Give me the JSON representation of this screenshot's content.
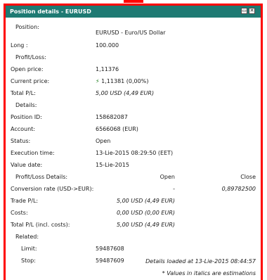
{
  "window": {
    "title": "Position details - EURUSD"
  },
  "position": {
    "label": "Position:",
    "value": "EURUSD - Euro/US Dollar"
  },
  "side": {
    "label": "Long :",
    "value": "100.000"
  },
  "pl_section": "Profit/Loss:",
  "open_price": {
    "label": "Open price:",
    "value": "1,11376"
  },
  "current_price": {
    "label": "Current price:",
    "icon": "up-arrow-icon",
    "value": "1,11381 (0,00%)"
  },
  "total_pl": {
    "label": "Total P/L:",
    "value": "5,00 USD (4,49 EUR)"
  },
  "details_section": "Details:",
  "position_id": {
    "label": "Position ID:",
    "value": "158682087"
  },
  "account": {
    "label": "Account:",
    "value": "6566068 (EUR)"
  },
  "status": {
    "label": "Status:",
    "value": "Open"
  },
  "execution_time": {
    "label": "Execution time:",
    "value": "13-Lie-2015 08:29:50 (EET)"
  },
  "value_date": {
    "label": "Value date:",
    "value": "15-Lie-2015"
  },
  "pl_details": {
    "label": "Profit/Loss Details:",
    "col_open": "Open",
    "col_close": "Close",
    "rows": [
      {
        "label": "Conversion rate (USD->EUR):",
        "open": "-",
        "close": "0,89782500"
      },
      {
        "label": "Trade P/L:",
        "open": "5,00 USD (4,49 EUR)",
        "close": ""
      },
      {
        "label": "Costs:",
        "open": "0,00 USD (0,00 EUR)",
        "close": ""
      },
      {
        "label": "Total P/L (incl. costs):",
        "open": "5,00 USD (4,49 EUR)",
        "close": ""
      }
    ]
  },
  "related_section": "Related:",
  "limit": {
    "label": "Limit:",
    "value": "59487608"
  },
  "stop": {
    "label": "Stop:",
    "value": "59487609"
  },
  "footer": {
    "loaded": "Details loaded at 13-Lie-2015 08:44:57",
    "note": "* Values in italics are estimations"
  },
  "colors": {
    "titlebar": "#1e7a73",
    "border": "#ff0000",
    "up_arrow": "#1a7a1a"
  }
}
